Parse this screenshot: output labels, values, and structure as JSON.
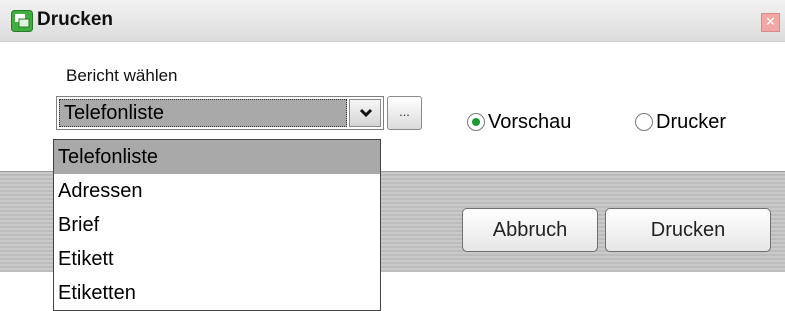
{
  "window": {
    "title": "Drucken",
    "close_icon": "close-icon"
  },
  "report": {
    "label": "Bericht wählen",
    "selected": "Telefonliste",
    "browse_label": "...",
    "options": [
      "Telefonliste",
      "Adressen",
      "Brief",
      "Etikett",
      "Etiketten"
    ]
  },
  "output": {
    "options": [
      {
        "label": "Vorschau",
        "checked": true
      },
      {
        "label": "Drucker",
        "checked": false
      }
    ]
  },
  "buttons": {
    "cancel": "Abbruch",
    "print": "Drucken"
  },
  "colors": {
    "radio_checked": "#1a9a30",
    "selection": "#a9a9a9"
  }
}
